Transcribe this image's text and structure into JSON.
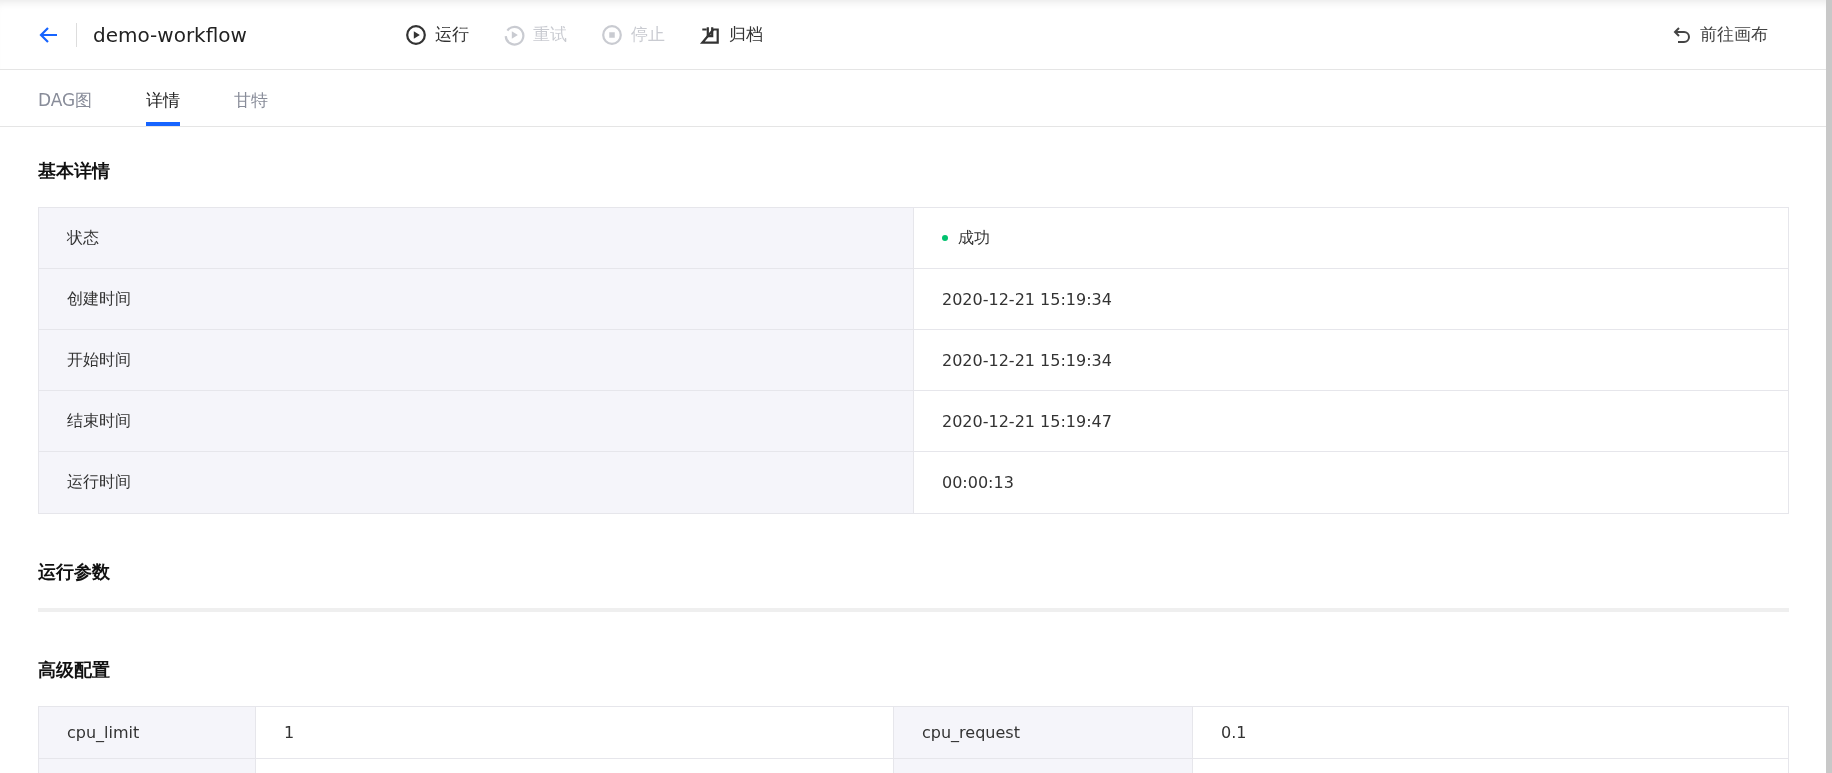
{
  "header": {
    "title": "demo-workflow",
    "actions": [
      {
        "kind": "run",
        "label": "运行",
        "disabled": false
      },
      {
        "kind": "retry",
        "label": "重试",
        "disabled": true
      },
      {
        "kind": "stop",
        "label": "停止",
        "disabled": true
      },
      {
        "kind": "archive",
        "label": "归档",
        "disabled": false
      }
    ],
    "canvas_link": "前往画布"
  },
  "tabs": [
    {
      "label": "DAG图",
      "selected": false
    },
    {
      "label": "详情",
      "selected": true
    },
    {
      "label": "甘特",
      "selected": false
    }
  ],
  "basic": {
    "heading": "基本详情",
    "rows": [
      {
        "label": "状态",
        "value": "成功",
        "color": "#00c26e"
      },
      {
        "label": "创建时间",
        "value": "2020-12-21 15:19:34"
      },
      {
        "label": "开始时间",
        "value": "2020-12-21 15:19:34"
      },
      {
        "label": "结束时间",
        "value": "2020-12-21 15:19:47"
      },
      {
        "label": "运行时间",
        "value": "00:00:13"
      }
    ]
  },
  "params": {
    "heading": "运行参数"
  },
  "advanced": {
    "heading": "高级配置",
    "rows": [
      {
        "label_1": "cpu_limit",
        "value_1": "1",
        "label_2": "cpu_request",
        "value_2": "0.1"
      }
    ]
  }
}
